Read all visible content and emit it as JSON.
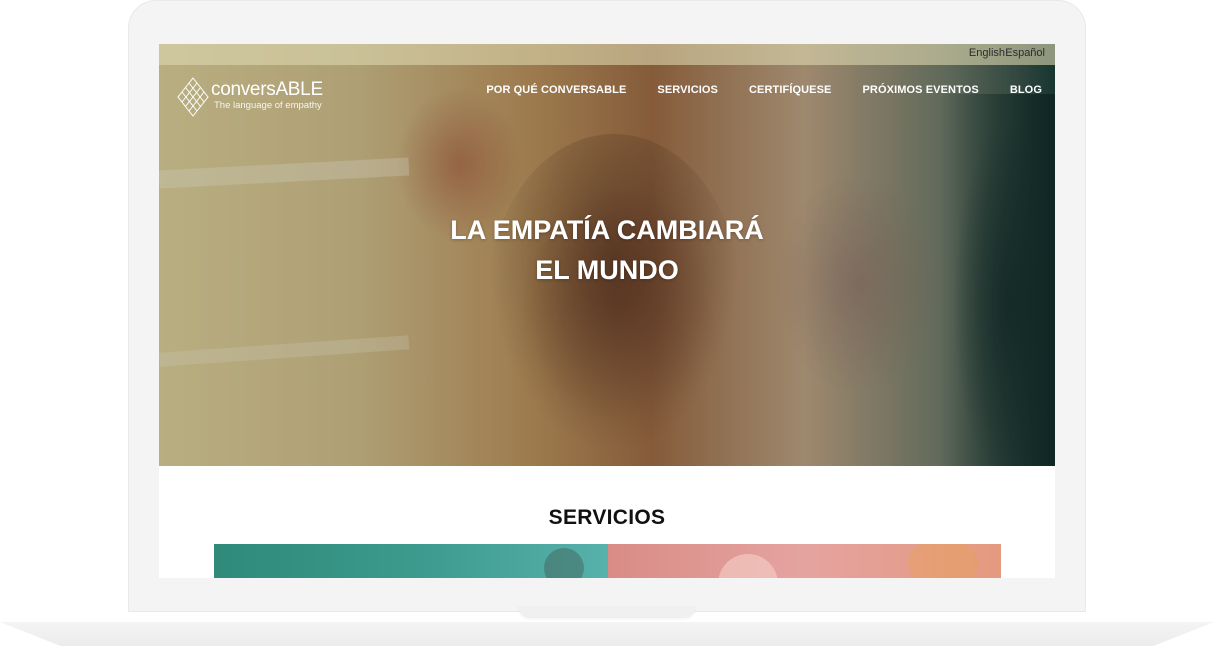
{
  "topbar": {
    "languages": [
      "English",
      "Español"
    ]
  },
  "logo": {
    "name_lower": "convers",
    "name_upper": "ABLE",
    "tagline": "The language of empathy"
  },
  "nav": {
    "items": [
      "POR QUÉ CONVERSABLE",
      "SERVICIOS",
      "CERTIFÍQUESE",
      "PRÓXIMOS EVENTOS",
      "BLOG"
    ]
  },
  "hero": {
    "title_line1": "LA EMPATÍA CAMBIARÁ",
    "title_line2": "EL MUNDO"
  },
  "services": {
    "heading": "SERVICIOS"
  },
  "colors": {
    "text_dark": "#111111",
    "nav_text": "#ffffff",
    "card_teal": "#3a9a8c",
    "card_pink": "#e5a3a0"
  }
}
